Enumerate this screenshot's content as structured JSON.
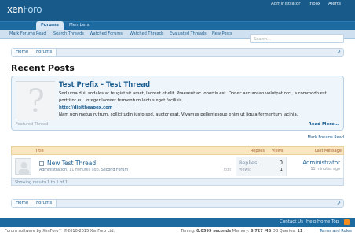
{
  "header": {
    "logo_a": "xen",
    "logo_b": "Foro",
    "tabs": [
      "Forums",
      "Members"
    ],
    "right": [
      "Administrator",
      "Inbox",
      "Alerts"
    ]
  },
  "subnav": {
    "links": [
      "Mark Forums Read",
      "Search Threads",
      "Watched Forums",
      "Watched Threads",
      "Evaluated Threads",
      "New Posts"
    ],
    "search_placeholder": "Search..."
  },
  "breadcrumb": {
    "items": [
      "Home",
      "Forums"
    ],
    "jump_icon": "⇗"
  },
  "page_title": "Recent Posts",
  "featured": {
    "title": "Test Prefix - Test Thread",
    "body1": "Sed urna dui, sodales at feugiat sit amet, laoreet et elit. Praesent ac lobortis est. Donec accumsan volutpat orci, a commodo est porttitor eu. Integer laoreet fermentum lectus eget facilisis.",
    "link": "http://dipitheapex.com",
    "body2": "Nam non metus rutrum, sollicitudin justo sed, auctor erat. Vivamus pellentesque enim ut ligula fermentum lacinia.",
    "tag": "Featured Thread",
    "more": "Read More..."
  },
  "mark_read": "Mark Forums Read",
  "table": {
    "headers": {
      "title": "Title",
      "replies": "Replies",
      "views": "Views",
      "last": "Last Message"
    },
    "row": {
      "title": "New Test Thread",
      "author": "Administration",
      "time": "11 minutes ago",
      "forum": "Second Forum",
      "edit": "Edit",
      "replies_label": "Replies:",
      "replies": "0",
      "views_label": "Views:",
      "views": "1",
      "last_user": "Administrator",
      "last_time": "11 minutes ago"
    },
    "footer": "Showing results 1 to 1 of 1"
  },
  "footer": {
    "links": [
      "Contact Us",
      "Help",
      "Home",
      "Top"
    ],
    "rss_icon": "rss-icon",
    "copyright": "Forum software by XenForo™ ©2010-2015 XenForo Ltd.",
    "timing_label": "Timing:",
    "timing": "0.0599 seconds",
    "memory_label": "Memory:",
    "memory": "6.727 MB",
    "db_label": "DB Queries:",
    "db": "11",
    "terms": "Terms and Rules"
  },
  "colors": {
    "header": "#185b8a",
    "accent": "#1c5e91",
    "table_head": "#fbe6c2"
  }
}
